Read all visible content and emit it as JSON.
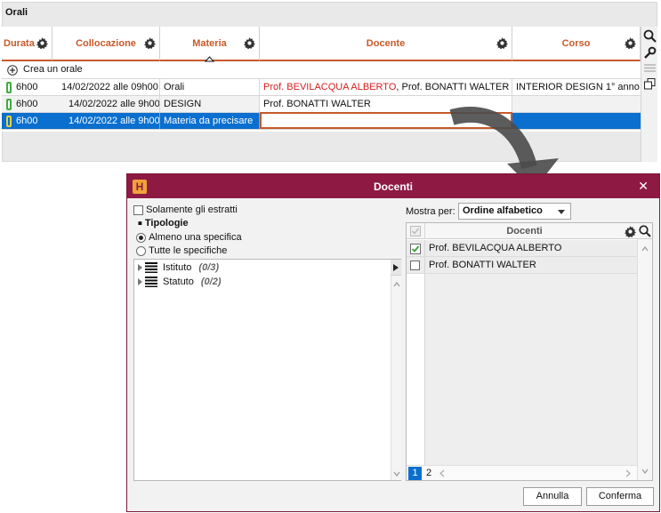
{
  "panel": {
    "title": "Orali"
  },
  "grid": {
    "columns": [
      {
        "label": "Durata"
      },
      {
        "label": "Collocazione"
      },
      {
        "label": "Materia"
      },
      {
        "label": "Docente"
      },
      {
        "label": "Corso"
      }
    ],
    "create_label": "Crea un orale",
    "rows": [
      {
        "durata": "6h00",
        "collocazione": "14/02/2022  alle 09h00",
        "materia": "Orali",
        "docente_main": "Prof. BEVILACQUA ALBERTO",
        "docente_rest": ", Prof. BONATTI WALTER",
        "corso": "INTERIOR DESIGN  1° anno"
      },
      {
        "durata": "6h00",
        "collocazione": "14/02/2022 alle 9h00",
        "materia": "DESIGN",
        "docente_main": "",
        "docente_rest": "Prof. BONATTI WALTER",
        "corso": ""
      },
      {
        "durata": "6h00",
        "collocazione": "14/02/2022 alle 9h00",
        "materia": "Materia da precisare",
        "docente_main": "",
        "docente_rest": "",
        "corso": ""
      }
    ]
  },
  "dialog": {
    "logo": "H",
    "title": "Docenti",
    "close_glyph": "✕",
    "only_extracted_label": "Solamente gli estratti",
    "typologies_label": "Tipologie",
    "radio_options": [
      {
        "label": "Almeno una specifica",
        "selected": true
      },
      {
        "label": "Tutte le specifiche",
        "selected": false
      }
    ],
    "tree_items": [
      {
        "label": "Istituto",
        "count": "(0/3)"
      },
      {
        "label": "Statuto",
        "count": "(0/2)"
      }
    ],
    "show_by_label": "Mostra per:",
    "show_by_value": "Ordine alfabetico",
    "list_header": "Docenti",
    "list_items": [
      {
        "label": "Prof. BEVILACQUA ALBERTO",
        "checked": true
      },
      {
        "label": "Prof. BONATTI WALTER",
        "checked": false
      }
    ],
    "pages": [
      "1",
      "2"
    ],
    "cancel_label": "Annulla",
    "confirm_label": "Conferma"
  },
  "colors": {
    "accent": "#c85a2a",
    "selection": "#0a6fcf",
    "dialog_title_bar": "#8e1a44",
    "red_name": "#d42020"
  }
}
